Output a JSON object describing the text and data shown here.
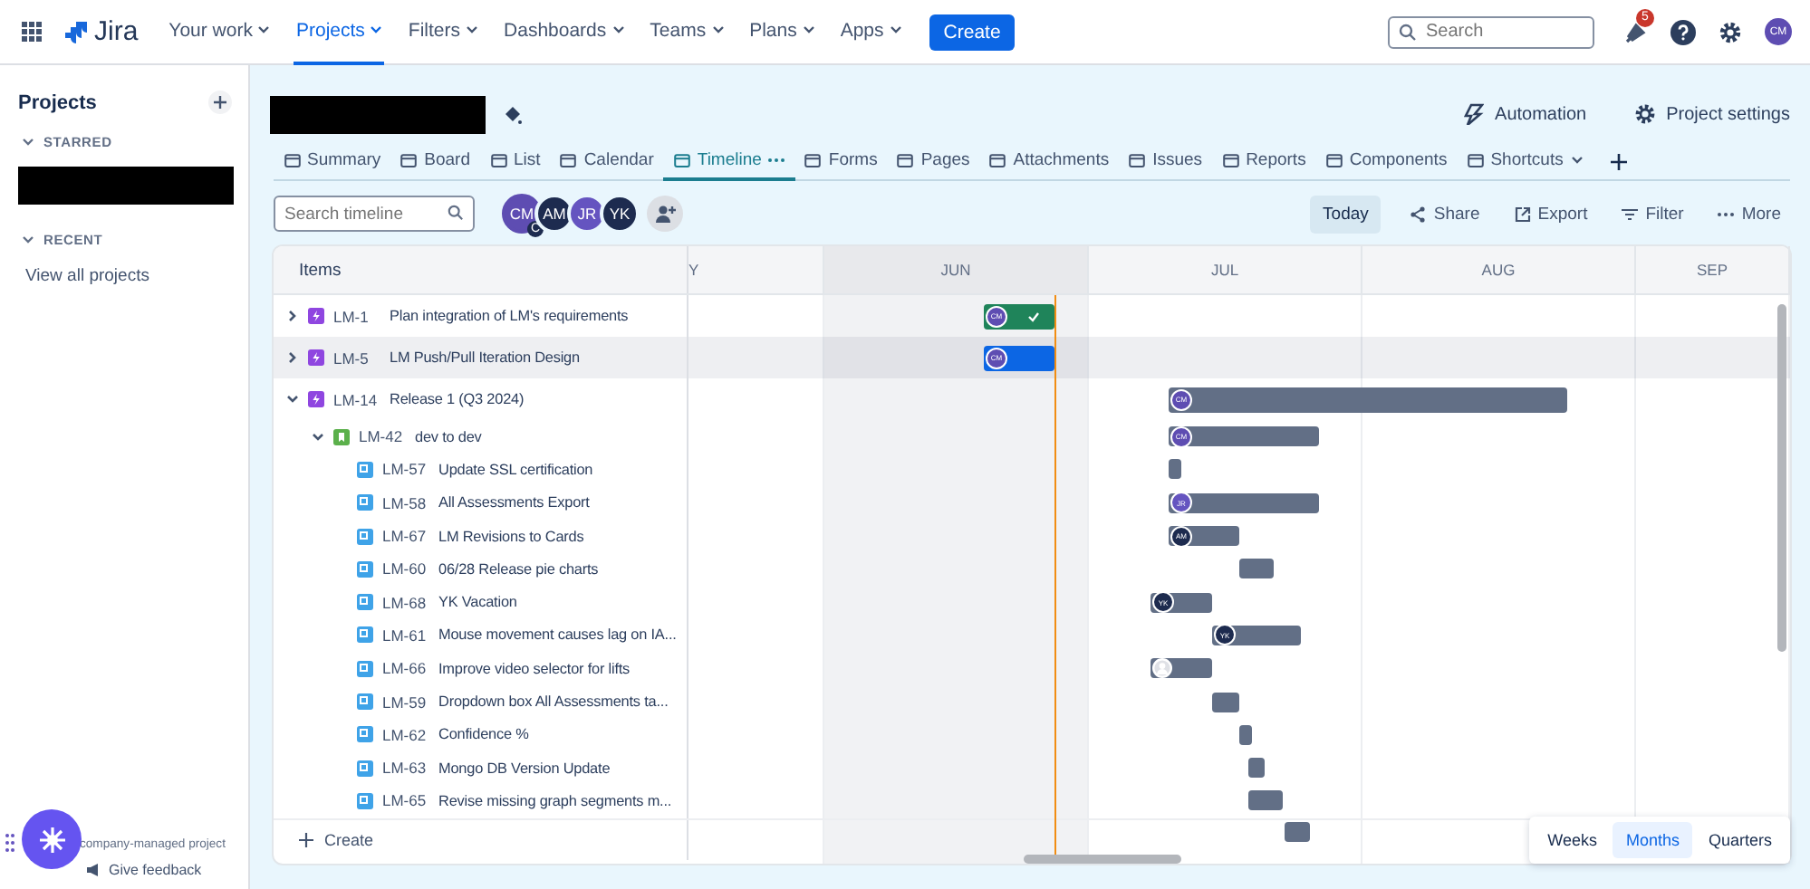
{
  "topnav": {
    "logo": "Jira",
    "items": [
      {
        "label": "Your work",
        "selected": false
      },
      {
        "label": "Projects",
        "selected": true
      },
      {
        "label": "Filters",
        "selected": false
      },
      {
        "label": "Dashboards",
        "selected": false
      },
      {
        "label": "Teams",
        "selected": false
      },
      {
        "label": "Plans",
        "selected": false
      },
      {
        "label": "Apps",
        "selected": false
      }
    ],
    "create": "Create",
    "search": {
      "placeholder": "Search"
    },
    "notifications": "5",
    "avatar": "CM"
  },
  "sidebar": {
    "title": "Projects",
    "sections": [
      {
        "label": "STARRED",
        "redacted": true
      },
      {
        "label": "RECENT",
        "redacted": false
      }
    ],
    "view_all": "View all projects",
    "footer": {
      "project_type": "company-managed project",
      "feedback": "Give feedback"
    }
  },
  "project": {
    "actions": [
      "Automation",
      "Project settings"
    ],
    "tabs": [
      {
        "label": "Summary",
        "selected": false
      },
      {
        "label": "Board",
        "selected": false
      },
      {
        "label": "List",
        "selected": false
      },
      {
        "label": "Calendar",
        "selected": false
      },
      {
        "label": "Timeline",
        "selected": true
      },
      {
        "label": "Forms",
        "selected": false
      },
      {
        "label": "Pages",
        "selected": false
      },
      {
        "label": "Attachments",
        "selected": false
      },
      {
        "label": "Issues",
        "selected": false
      },
      {
        "label": "Reports",
        "selected": false
      },
      {
        "label": "Components",
        "selected": false
      },
      {
        "label": "Shortcuts",
        "selected": false
      }
    ]
  },
  "toolbar": {
    "search": {
      "placeholder": "Search timeline"
    },
    "avatars": [
      {
        "text": "CM",
        "color": "#5e4db2",
        "badge": "C"
      },
      {
        "text": "AM",
        "color": "#1d2b4f"
      },
      {
        "text": "JR",
        "color": "#6554c0"
      },
      {
        "text": "YK",
        "color": "#1d2b4f"
      }
    ],
    "buttons": [
      "Today",
      "Share",
      "Export",
      "Filter",
      "More"
    ]
  },
  "timeline": {
    "items_header": "Items",
    "months": [
      "Y",
      "JUN",
      "JUL",
      "AUG",
      "SEP"
    ],
    "rows": [
      {
        "key": "LM-1",
        "summary": "Plan integration of LM's requirements",
        "kind": "epic",
        "expanded": false,
        "highlighted": false,
        "bar": {
          "kind": "done",
          "avatar": {
            "kind": "initials",
            "text": "CM",
            "color": "#5e4db2"
          }
        }
      },
      {
        "key": "LM-5",
        "summary": "LM Push/Pull Iteration Design",
        "kind": "epic",
        "expanded": false,
        "highlighted": true,
        "bar": {
          "kind": "in_progress",
          "avatar": {
            "kind": "initials",
            "text": "CM",
            "color": "#5e4db2"
          }
        }
      },
      {
        "key": "LM-14",
        "summary": "Release 1 (Q3 2024)",
        "kind": "epic",
        "expanded": true,
        "highlighted": false,
        "bar": {
          "kind": "todo",
          "avatar": {
            "kind": "initials",
            "text": "CM",
            "color": "#5e4db2"
          }
        },
        "children": [
          {
            "key": "LM-42",
            "summary": "dev to dev",
            "kind": "story",
            "expanded": true,
            "highlighted": false,
            "bar": {
              "kind": "todo",
              "avatar": {
                "kind": "initials",
                "text": "CM",
                "color": "#5e4db2"
              }
            },
            "children": [
              {
                "key": "LM-57",
                "summary": "Update SSL certification",
                "kind": "task",
                "highlighted": false,
                "bar": {
                  "kind": "todo"
                }
              },
              {
                "key": "LM-58",
                "summary": "All Assessments Export",
                "kind": "task",
                "highlighted": false,
                "bar": {
                  "kind": "todo",
                  "avatar": {
                    "kind": "initials",
                    "text": "JR",
                    "color": "#6554c0"
                  }
                }
              },
              {
                "key": "LM-67",
                "summary": "LM Revisions to Cards",
                "kind": "task",
                "highlighted": false,
                "bar": {
                  "kind": "todo",
                  "avatar": {
                    "kind": "initials",
                    "text": "AM",
                    "color": "#1d2b4f"
                  }
                }
              },
              {
                "key": "LM-60",
                "summary": "06/28 Release pie charts",
                "kind": "task",
                "highlighted": false,
                "bar": {
                  "kind": "todo"
                }
              },
              {
                "key": "LM-68",
                "summary": "YK Vacation",
                "kind": "task",
                "highlighted": false,
                "bar": {
                  "kind": "todo",
                  "avatar": {
                    "kind": "initials",
                    "text": "YK",
                    "color": "#1d2b4f"
                  }
                }
              },
              {
                "key": "LM-61",
                "summary": "Mouse movement causes lag on IA...",
                "kind": "task",
                "highlighted": false,
                "bar": {
                  "kind": "todo",
                  "avatar": {
                    "kind": "initials",
                    "text": "YK",
                    "color": "#1d2b4f"
                  }
                }
              },
              {
                "key": "LM-66",
                "summary": "Improve video selector for lifts",
                "kind": "task",
                "highlighted": false,
                "bar": {
                  "kind": "todo",
                  "avatar": {
                    "kind": "person"
                  }
                }
              },
              {
                "key": "LM-59",
                "summary": "Dropdown box All Assessments ta...",
                "kind": "task",
                "highlighted": false,
                "bar": {
                  "kind": "todo"
                }
              },
              {
                "key": "LM-62",
                "summary": "Confidence %",
                "kind": "task",
                "highlighted": false,
                "bar": {
                  "kind": "todo"
                }
              },
              {
                "key": "LM-63",
                "summary": "Mongo DB Version Update",
                "kind": "task",
                "highlighted": false,
                "bar": {
                  "kind": "todo"
                }
              },
              {
                "key": "LM-65",
                "summary": "Revise missing graph segments m...",
                "kind": "task",
                "highlighted": false,
                "bar": {
                  "kind": "todo"
                }
              }
            ]
          }
        ]
      }
    ],
    "partial_row": {
      "bar": {
        "kind": "todo"
      }
    },
    "create": "Create",
    "views": [
      {
        "label": "Weeks",
        "selected": false
      },
      {
        "label": "Months",
        "selected": true
      },
      {
        "label": "Quarters",
        "selected": false
      }
    ]
  }
}
